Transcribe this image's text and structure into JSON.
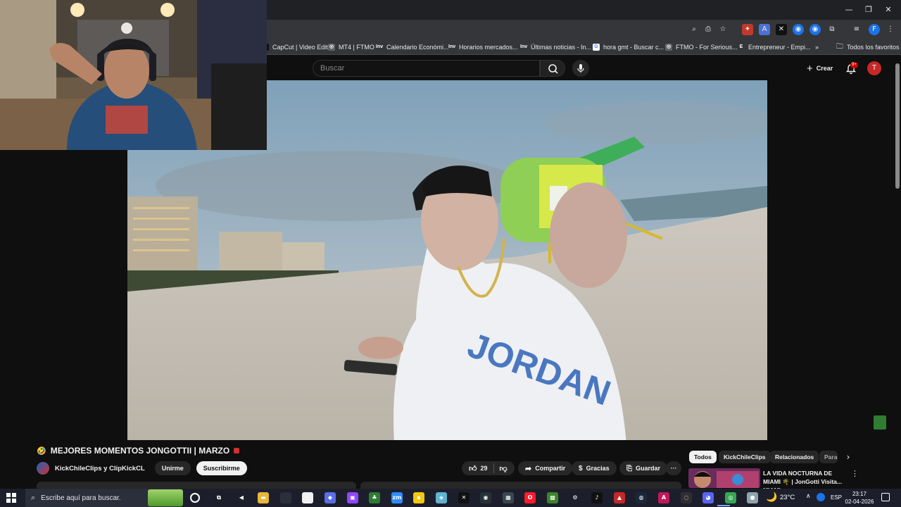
{
  "browser": {
    "toolbar_icons": [
      "zoom-icon",
      "install-icon",
      "star-icon",
      "extension-icon",
      "translate-icon",
      "extension-icon",
      "extension-icon",
      "extension-icon",
      "puzzle-icon",
      "media-icon",
      "profile-icon",
      "menu-icon"
    ],
    "profile_letter": "F",
    "bookmarks": [
      {
        "label": "CapCut | Video Edit...",
        "icon": "capcut-icon",
        "color": "#111111",
        "glyph": ""
      },
      {
        "label": "MT4 | FTMO",
        "icon": "globe-icon",
        "color": "#5f6368",
        "glyph": "◎"
      },
      {
        "label": "Calendario Económi...",
        "icon": "investing-icon",
        "color": "#35363a",
        "glyph": "Inv"
      },
      {
        "label": "Horarios mercados...",
        "icon": "investing-icon",
        "color": "#35363a",
        "glyph": "Inv"
      },
      {
        "label": "Últimas noticias - In...",
        "icon": "investing-icon",
        "color": "#35363a",
        "glyph": "Inv"
      },
      {
        "label": "hora gmt - Buscar c...",
        "icon": "google-icon",
        "color": "#ffffff",
        "glyph": "G"
      },
      {
        "label": "FTMO - For Serious...",
        "icon": "globe-icon",
        "color": "#5f6368",
        "glyph": "◎"
      },
      {
        "label": "Entrepreneur - Empi...",
        "icon": "entrepreneur-icon",
        "color": "#35363a",
        "glyph": "E"
      }
    ],
    "bookmarks_more": "»",
    "all_bookmarks": "Todos los favoritos"
  },
  "youtube": {
    "search_placeholder": "Buscar",
    "create_label": "Crear",
    "notifications_badge": "9+",
    "avatar_letter": "T",
    "video": {
      "title": "MEJORES MOMENTOS JONGOTTII | MARZO",
      "title_emoji_left": "🤣",
      "channel": "KickChileClips y ClipKickCL",
      "join_label": "Unirme",
      "subscribe_label": "Suscribirme",
      "likes": "29",
      "share_label": "Compartir",
      "thanks_label": "Gracias",
      "save_label": "Guardar",
      "more_label": "···"
    },
    "chips": [
      "Todos",
      "KickChileClips",
      "Relacionados",
      "Para"
    ],
    "related": {
      "title": "LA VIDA NOCTURNA DE MIAMI 🌴 | JonGotti Visita... MIAMI ...",
      "more": "⋮"
    }
  },
  "taskbar": {
    "search_placeholder": "Escribe aquí para buscar.",
    "weather": "23°C",
    "language": "ESP",
    "time": "23:17",
    "date": "02-04-2026",
    "apps": [
      {
        "name": "task-view-icon",
        "glyph": "⧉",
        "color": "#1c1f2b"
      },
      {
        "name": "app-arrow-icon",
        "glyph": "◀",
        "color": "#1c1f2b"
      },
      {
        "name": "file-explorer-icon",
        "glyph": "▬",
        "color": "#e8b63a"
      },
      {
        "name": "app-blank-icon",
        "glyph": "",
        "color": "#2b2e3b"
      },
      {
        "name": "notepad-icon",
        "glyph": "▯",
        "color": "#f0f0f0"
      },
      {
        "name": "copilot-icon",
        "glyph": "◆",
        "color": "#5a6ee8"
      },
      {
        "name": "twitch-icon",
        "glyph": "▣",
        "color": "#9146ff"
      },
      {
        "name": "app-tree-icon",
        "glyph": "♣",
        "color": "#2e7d32"
      },
      {
        "name": "zoom-app-icon",
        "glyph": "zm",
        "color": "#2d8cff"
      },
      {
        "name": "sticky-notes-icon",
        "glyph": "▪",
        "color": "#f2c811"
      },
      {
        "name": "app-cube-icon",
        "glyph": "◈",
        "color": "#5fb3d0"
      },
      {
        "name": "capcut-app-icon",
        "glyph": "✕",
        "color": "#111111"
      },
      {
        "name": "app-disc-icon",
        "glyph": "◉",
        "color": "#263238"
      },
      {
        "name": "app-media-icon",
        "glyph": "▦",
        "color": "#37474f"
      },
      {
        "name": "opera-icon",
        "glyph": "O",
        "color": "#ff1b2d"
      },
      {
        "name": "minecraft-icon",
        "glyph": "▩",
        "color": "#3c8527"
      },
      {
        "name": "settings-icon",
        "glyph": "⚙",
        "color": "#1c1f2b"
      },
      {
        "name": "tiktok-icon",
        "glyph": "♪",
        "color": "#111111"
      },
      {
        "name": "app-red-icon",
        "glyph": "▲",
        "color": "#c62828"
      },
      {
        "name": "steam-icon",
        "glyph": "◍",
        "color": "#1b2838"
      },
      {
        "name": "adobe-icon",
        "glyph": "A",
        "color": "#c2185b"
      },
      {
        "name": "obs-icon",
        "glyph": "◌",
        "color": "#302e31"
      },
      {
        "name": "discord-icon",
        "glyph": "◕",
        "color": "#5865f2"
      },
      {
        "name": "chrome-icon",
        "glyph": "◎",
        "color": "#34a853"
      },
      {
        "name": "app-gray-icon",
        "glyph": "●",
        "color": "#90a4ae"
      }
    ]
  }
}
